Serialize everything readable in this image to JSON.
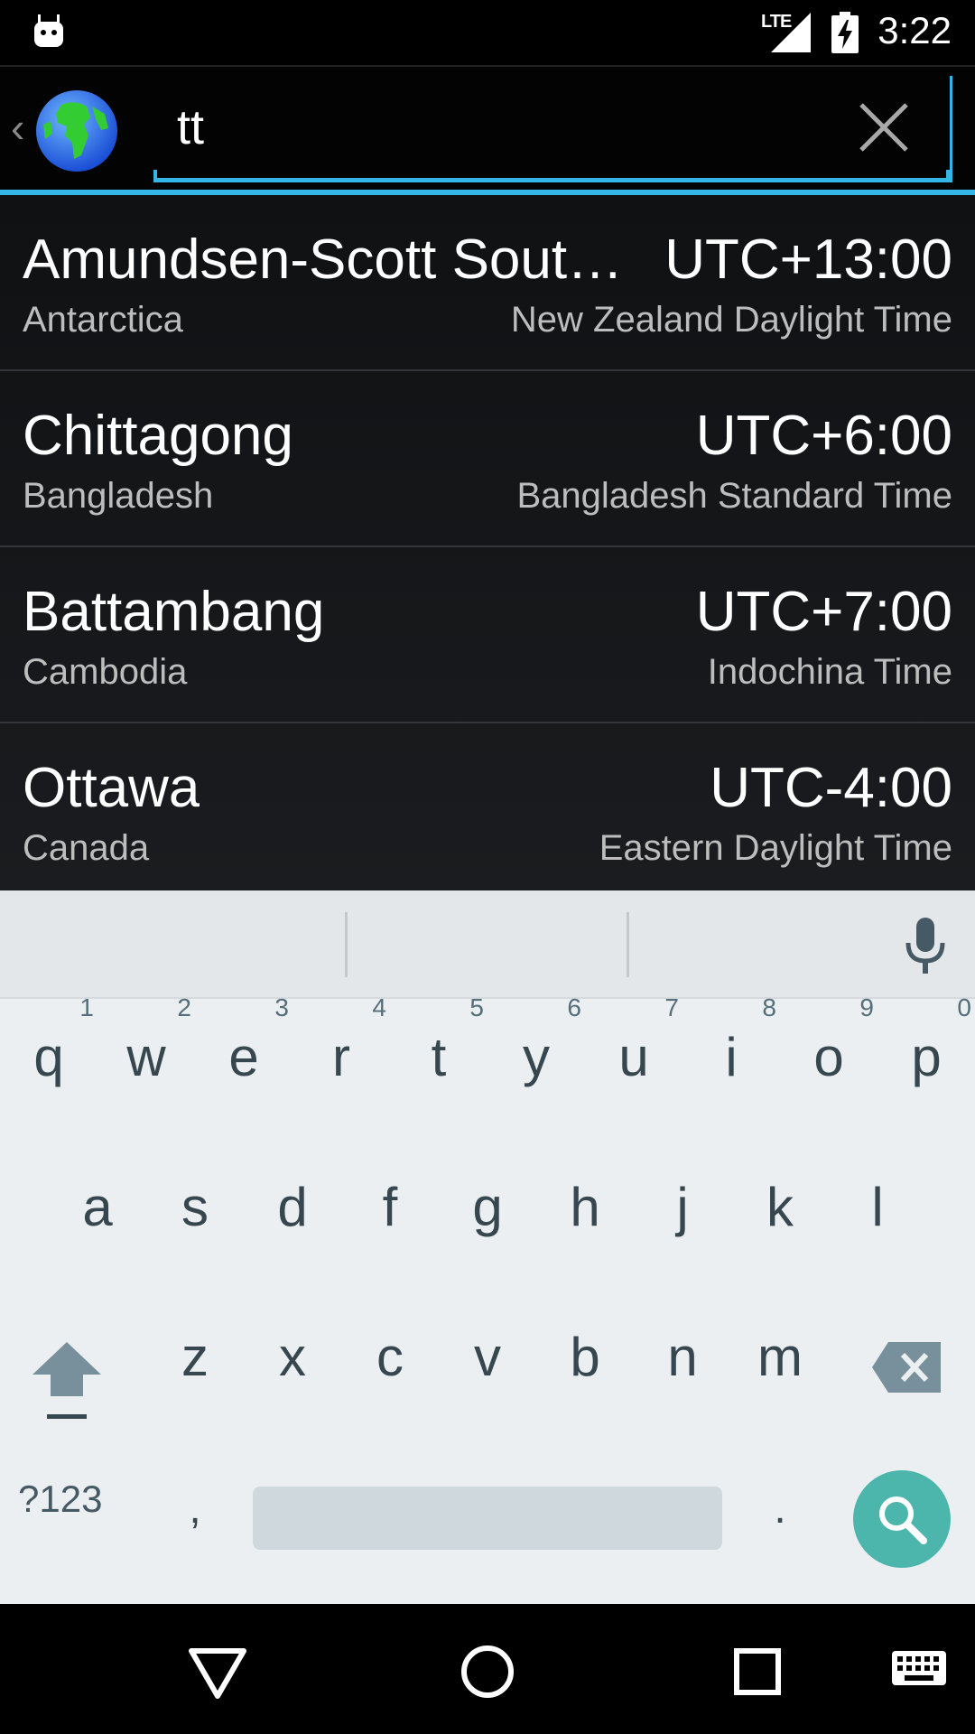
{
  "status_bar": {
    "network": "LTE",
    "time": "3:22",
    "icons": [
      "android-debug-icon",
      "signal-icon",
      "battery-charging-icon"
    ]
  },
  "search": {
    "back_icon": "chevron-left-icon",
    "app_icon": "globe-icon",
    "query": "tt",
    "clear_icon": "close-icon",
    "accent_color": "#33b5e5"
  },
  "results": [
    {
      "city": "Amundsen-Scott Sout…",
      "country": "Antarctica",
      "offset": "UTC+13:00",
      "timezone": "New Zealand Daylight Time"
    },
    {
      "city": "Chittagong",
      "country": "Bangladesh",
      "offset": "UTC+6:00",
      "timezone": "Bangladesh Standard Time"
    },
    {
      "city": "Battambang",
      "country": "Cambodia",
      "offset": "UTC+7:00",
      "timezone": "Indochina Time"
    },
    {
      "city": "Ottawa",
      "country": "Canada",
      "offset": "UTC-4:00",
      "timezone": "Eastern Daylight Time"
    }
  ],
  "keyboard": {
    "mic_icon": "microphone-icon",
    "row1": [
      "q",
      "w",
      "e",
      "r",
      "t",
      "y",
      "u",
      "i",
      "o",
      "p"
    ],
    "row1_hints": [
      "1",
      "2",
      "3",
      "4",
      "5",
      "6",
      "7",
      "8",
      "9",
      "0"
    ],
    "row2": [
      "a",
      "s",
      "d",
      "f",
      "g",
      "h",
      "j",
      "k",
      "l"
    ],
    "row3": [
      "z",
      "x",
      "c",
      "v",
      "b",
      "n",
      "m"
    ],
    "shift_icon": "shift-icon",
    "backspace_icon": "backspace-icon",
    "symbols_label": "?123",
    "comma": ",",
    "period": ".",
    "search_icon": "search-icon",
    "search_key_color": "#4db6ac"
  },
  "nav_bar": {
    "back_icon": "back-triangle-icon",
    "home_icon": "home-circle-icon",
    "recents_icon": "recents-square-icon",
    "keyboard_icon": "keyboard-icon"
  }
}
